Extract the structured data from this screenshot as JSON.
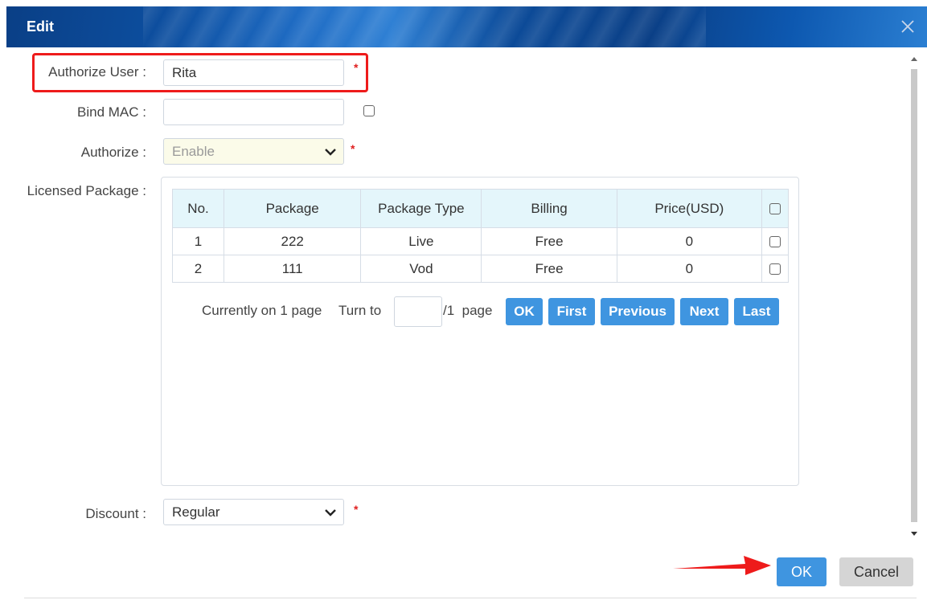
{
  "dialog": {
    "title": "Edit"
  },
  "form": {
    "authorize_user": {
      "label": "Authorize User :",
      "value": "Rita",
      "required_mark": "*"
    },
    "bind_mac": {
      "label": "Bind MAC :",
      "value": ""
    },
    "authorize": {
      "label": "Authorize :",
      "selected": "Enable",
      "required_mark": "*"
    },
    "licensed_package": {
      "label": "Licensed Package :"
    },
    "discount": {
      "label": "Discount :",
      "selected": "Regular",
      "required_mark": "*"
    }
  },
  "package_table": {
    "columns": [
      "No.",
      "Package",
      "Package Type",
      "Billing",
      "Price(USD)"
    ],
    "rows": [
      {
        "no": "1",
        "package": "222",
        "type": "Live",
        "billing": "Free",
        "price": "0"
      },
      {
        "no": "2",
        "package": "111",
        "type": "Vod",
        "billing": "Free",
        "price": "0"
      }
    ]
  },
  "pager": {
    "current": "Currently on 1 page",
    "turn_to": "Turn to",
    "total": "/1  page",
    "buttons": {
      "ok": "OK",
      "first": "First",
      "previous": "Previous",
      "next": "Next",
      "last": "Last"
    }
  },
  "footer": {
    "ok": "OK",
    "cancel": "Cancel"
  },
  "colors": {
    "accent": "#3f95e0",
    "highlight": "#ee1b1b",
    "header_bg": "#e4f6fb"
  }
}
